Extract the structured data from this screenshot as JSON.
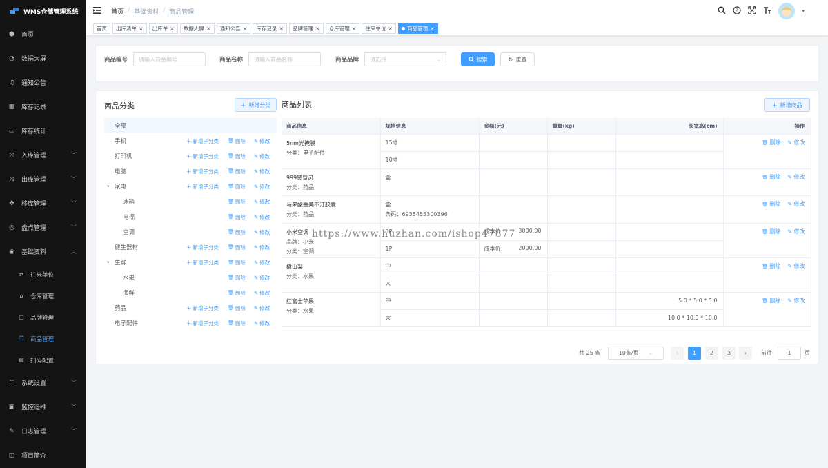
{
  "app": {
    "title": "WMS仓储管理系统",
    "brand_color": "#409eff",
    "sidebar_bg": "#141414"
  },
  "sidebar": {
    "items": [
      {
        "label": "首页",
        "icon": "cube-icon"
      },
      {
        "label": "数据大屏",
        "icon": "dashboard-icon"
      },
      {
        "label": "通知公告",
        "icon": "bell-icon"
      },
      {
        "label": "库存记录",
        "icon": "grid-icon"
      },
      {
        "label": "库存统计",
        "icon": "monitor-icon"
      },
      {
        "label": "入库管理",
        "icon": "inbound-icon",
        "expandable": true
      },
      {
        "label": "出库管理",
        "icon": "outbound-icon",
        "expandable": true
      },
      {
        "label": "移库管理",
        "icon": "move-icon",
        "expandable": true
      },
      {
        "label": "盘点管理",
        "icon": "target-icon",
        "expandable": true
      },
      {
        "label": "基础资料",
        "icon": "circle-dot-icon",
        "expanded": true
      },
      {
        "label": "系统设置",
        "icon": "settings-icon",
        "expandable": true
      },
      {
        "label": "监控运维",
        "icon": "monitor-ops-icon",
        "expandable": true
      },
      {
        "label": "日志管理",
        "icon": "log-icon",
        "expandable": true
      },
      {
        "label": "项目简介",
        "icon": "book-icon"
      }
    ],
    "sub_items": [
      {
        "label": "往来单位",
        "icon": "link-icon"
      },
      {
        "label": "仓库管理",
        "icon": "warehouse-icon"
      },
      {
        "label": "品牌管理",
        "icon": "brand-icon"
      },
      {
        "label": "商品管理",
        "icon": "goods-icon",
        "active": true
      },
      {
        "label": "扫码配置",
        "icon": "scan-icon"
      }
    ]
  },
  "breadcrumb": [
    "首页",
    "基础资料",
    "商品管理"
  ],
  "tags": [
    {
      "label": "首页",
      "closable": false
    },
    {
      "label": "出库清单",
      "closable": true
    },
    {
      "label": "出库单",
      "closable": true
    },
    {
      "label": "数据大屏",
      "closable": true
    },
    {
      "label": "通知公告",
      "closable": true
    },
    {
      "label": "库存记录",
      "closable": true
    },
    {
      "label": "品牌管理",
      "closable": true
    },
    {
      "label": "仓库管理",
      "closable": true
    },
    {
      "label": "往来单位",
      "closable": true
    },
    {
      "label": "商品管理",
      "closable": true,
      "active": true
    }
  ],
  "search": {
    "code_label": "商品编号",
    "code_placeholder": "请输入商品编号",
    "name_label": "商品名称",
    "name_placeholder": "请输入商品名称",
    "brand_label": "商品品牌",
    "brand_placeholder": "请选择",
    "search_btn": "搜索",
    "reset_btn": "重置"
  },
  "category": {
    "title": "商品分类",
    "add_btn": "新增分类",
    "add_child": "新增子分类",
    "delete": "删除",
    "edit": "修改",
    "tree": [
      {
        "label": "全部",
        "level": 0,
        "selected": true,
        "actions": false
      },
      {
        "label": "手机",
        "level": 0,
        "add_child": true
      },
      {
        "label": "打印机",
        "level": 0,
        "add_child": true
      },
      {
        "label": "电脑",
        "level": 0,
        "add_child": true
      },
      {
        "label": "家电",
        "level": 0,
        "add_child": true,
        "caret": true
      },
      {
        "label": "冰箱",
        "level": 1,
        "add_child": false
      },
      {
        "label": "电视",
        "level": 1,
        "add_child": false
      },
      {
        "label": "空调",
        "level": 1,
        "add_child": false
      },
      {
        "label": "健生器材",
        "level": 0,
        "add_child": true
      },
      {
        "label": "生鲜",
        "level": 0,
        "add_child": true,
        "caret": true
      },
      {
        "label": "水果",
        "level": 1,
        "add_child": false
      },
      {
        "label": "海鲜",
        "level": 1,
        "add_child": false
      },
      {
        "label": "药品",
        "level": 0,
        "add_child": true
      },
      {
        "label": "电子配件",
        "level": 0,
        "add_child": true
      }
    ]
  },
  "goods": {
    "title": "商品列表",
    "add_btn": "新增商品",
    "columns": [
      "商品信息",
      "规格信息",
      "金额(元)",
      "重量(kg)",
      "长宽高(cm)",
      "操作"
    ],
    "delete": "删除",
    "edit": "修改",
    "rows": [
      {
        "name": "5nm光掩膜",
        "category": "分类：电子配件",
        "specs": [
          {
            "spec": "15寸",
            "price": "",
            "price_label": "",
            "size": ""
          },
          {
            "spec": "10寸",
            "price": "",
            "price_label": "",
            "size": ""
          }
        ]
      },
      {
        "name": "999感冒灵",
        "category": "分类：药品",
        "specs": [
          {
            "spec": "盒",
            "price": "",
            "price_label": "",
            "size": ""
          }
        ]
      },
      {
        "name": "马来酸曲美不汀胶囊",
        "category": "分类：药品",
        "specs": [
          {
            "spec": "盒\n条码：6935455300396",
            "price": "",
            "price_label": "",
            "size": ""
          }
        ]
      },
      {
        "name": "小米空调",
        "category": "品牌：小米\n分类：空调",
        "specs": [
          {
            "spec": "3P",
            "price": "3000.00",
            "price_label": "成本价：",
            "size": ""
          },
          {
            "spec": "1P",
            "price": "2000.00",
            "price_label": "成本价：",
            "size": ""
          }
        ]
      },
      {
        "name": "树山梨",
        "category": "分类：水果",
        "specs": [
          {
            "spec": "中",
            "price": "",
            "price_label": "",
            "size": ""
          },
          {
            "spec": "大",
            "price": "",
            "price_label": "",
            "size": ""
          }
        ]
      },
      {
        "name": "红富士苹果",
        "category": "分类：水果",
        "specs": [
          {
            "spec": "中",
            "price": "",
            "price_label": "",
            "size": "5.0 * 5.0 * 5.0"
          },
          {
            "spec": "大",
            "price": "",
            "price_label": "",
            "size": "10.0 * 10.0 * 10.0"
          }
        ]
      }
    ]
  },
  "pagination": {
    "total": "共 25 条",
    "page_size": "10条/页",
    "pages": [
      "1",
      "2",
      "3"
    ],
    "current": "1",
    "goto_label": "前往",
    "goto_value": "1",
    "goto_suffix": "页"
  },
  "watermark": "https://www.huzhan.com/ishop47877"
}
